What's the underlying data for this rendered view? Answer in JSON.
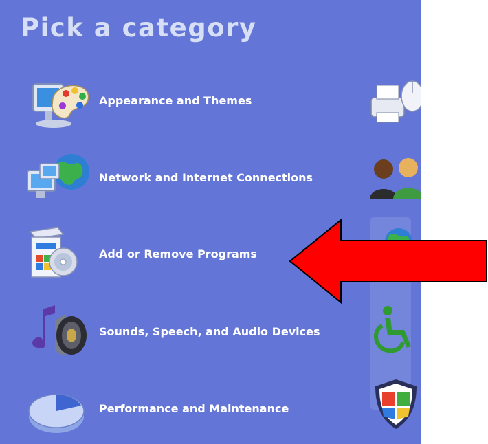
{
  "panel": {
    "title": "Pick a category",
    "categories": [
      {
        "label": "Appearance and Themes",
        "icon": "appearance-themes-icon"
      },
      {
        "label": "Network and Internet Connections",
        "icon": "network-connections-icon"
      },
      {
        "label": "Add or Remove Programs",
        "icon": "add-remove-programs-icon"
      },
      {
        "label": "Sounds, Speech, and Audio Devices",
        "icon": "sounds-audio-icon"
      },
      {
        "label": "Performance and Maintenance",
        "icon": "performance-maintenance-icon"
      }
    ],
    "right_column_icons": [
      "printers-hardware-icon",
      "user-accounts-icon",
      "regional-globe-icon",
      "accessibility-icon",
      "security-center-icon"
    ]
  },
  "annotation": {
    "arrow": "red-arrow-pointing-left",
    "color": "#ff0000"
  },
  "colors": {
    "panel_bg": "#6375d6",
    "title": "#d6dff5",
    "label": "#ffffff"
  }
}
